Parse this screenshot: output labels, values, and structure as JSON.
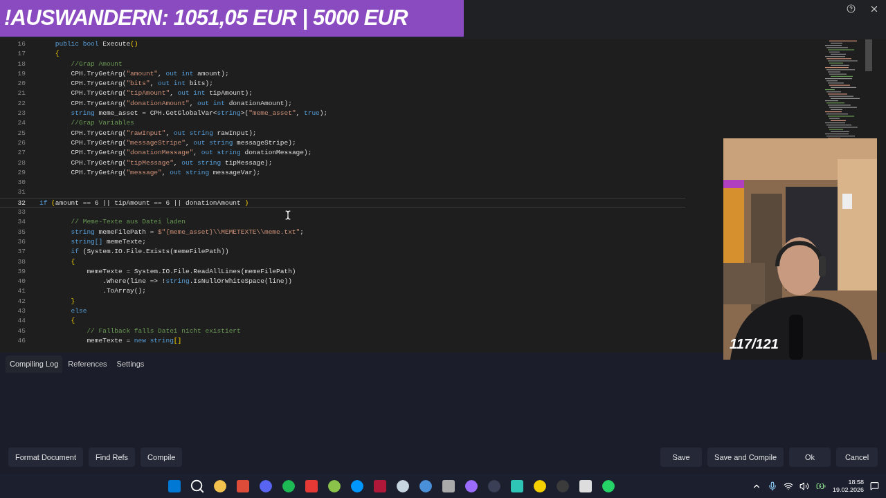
{
  "banner": {
    "text": "!AUSWANDERN: 1051,05 EUR | 5000 EUR"
  },
  "editor": {
    "lines": [
      {
        "num": "16",
        "current": false,
        "tokens": [
          {
            "kind": "keyword",
            "text": "    public bool "
          },
          {
            "kind": "plain",
            "text": "Execute"
          },
          {
            "kind": "bracket",
            "text": "()"
          }
        ]
      },
      {
        "num": "17",
        "current": false,
        "tokens": [
          {
            "kind": "bracket",
            "text": "    {"
          }
        ]
      },
      {
        "num": "18",
        "current": false,
        "tokens": [
          {
            "kind": "comment",
            "text": "        //Grap Amount"
          }
        ]
      },
      {
        "num": "19",
        "current": false,
        "tokens": [
          {
            "kind": "plain",
            "text": "        CPH.TryGetArg("
          },
          {
            "kind": "string",
            "text": "\"amount\""
          },
          {
            "kind": "plain",
            "text": ", "
          },
          {
            "kind": "keyword",
            "text": "out int "
          },
          {
            "kind": "plain",
            "text": "amount);"
          }
        ]
      },
      {
        "num": "20",
        "current": false,
        "tokens": [
          {
            "kind": "plain",
            "text": "        CPH.TryGetArg("
          },
          {
            "kind": "string",
            "text": "\"bits\""
          },
          {
            "kind": "plain",
            "text": ", "
          },
          {
            "kind": "keyword",
            "text": "out int "
          },
          {
            "kind": "plain",
            "text": "bits);"
          }
        ]
      },
      {
        "num": "21",
        "current": false,
        "tokens": [
          {
            "kind": "plain",
            "text": "        CPH.TryGetArg("
          },
          {
            "kind": "string",
            "text": "\"tipAmount\""
          },
          {
            "kind": "plain",
            "text": ", "
          },
          {
            "kind": "keyword",
            "text": "out int "
          },
          {
            "kind": "plain",
            "text": "tipAmount);"
          }
        ]
      },
      {
        "num": "22",
        "current": false,
        "tokens": [
          {
            "kind": "plain",
            "text": "        CPH.TryGetArg("
          },
          {
            "kind": "string",
            "text": "\"donationAmount\""
          },
          {
            "kind": "plain",
            "text": ", "
          },
          {
            "kind": "keyword",
            "text": "out int "
          },
          {
            "kind": "plain",
            "text": "donationAmount);"
          }
        ]
      },
      {
        "num": "23",
        "current": false,
        "tokens": [
          {
            "kind": "keyword",
            "text": "        string "
          },
          {
            "kind": "plain",
            "text": "meme_asset = CPH.GetGlobalVar<"
          },
          {
            "kind": "keyword",
            "text": "string"
          },
          {
            "kind": "plain",
            "text": ">("
          },
          {
            "kind": "string",
            "text": "\"meme_asset\""
          },
          {
            "kind": "plain",
            "text": ", "
          },
          {
            "kind": "keyword",
            "text": "true"
          },
          {
            "kind": "plain",
            "text": ");"
          }
        ]
      },
      {
        "num": "24",
        "current": false,
        "tokens": [
          {
            "kind": "comment",
            "text": "        //Grap Variables"
          }
        ]
      },
      {
        "num": "25",
        "current": false,
        "tokens": [
          {
            "kind": "plain",
            "text": "        CPH.TryGetArg("
          },
          {
            "kind": "string",
            "text": "\"rawInput\""
          },
          {
            "kind": "plain",
            "text": ", "
          },
          {
            "kind": "keyword",
            "text": "out string "
          },
          {
            "kind": "plain",
            "text": "rawInput);"
          }
        ]
      },
      {
        "num": "26",
        "current": false,
        "tokens": [
          {
            "kind": "plain",
            "text": "        CPH.TryGetArg("
          },
          {
            "kind": "string",
            "text": "\"messageStripe\""
          },
          {
            "kind": "plain",
            "text": ", "
          },
          {
            "kind": "keyword",
            "text": "out string "
          },
          {
            "kind": "plain",
            "text": "messageStripe);"
          }
        ]
      },
      {
        "num": "27",
        "current": false,
        "tokens": [
          {
            "kind": "plain",
            "text": "        CPH.TryGetArg("
          },
          {
            "kind": "string",
            "text": "\"donationMessage\""
          },
          {
            "kind": "plain",
            "text": ", "
          },
          {
            "kind": "keyword",
            "text": "out string "
          },
          {
            "kind": "plain",
            "text": "donationMessage);"
          }
        ]
      },
      {
        "num": "28",
        "current": false,
        "tokens": [
          {
            "kind": "plain",
            "text": "        CPH.TryGetArg("
          },
          {
            "kind": "string",
            "text": "\"tipMessage\""
          },
          {
            "kind": "plain",
            "text": ", "
          },
          {
            "kind": "keyword",
            "text": "out string "
          },
          {
            "kind": "plain",
            "text": "tipMessage);"
          }
        ]
      },
      {
        "num": "29",
        "current": false,
        "tokens": [
          {
            "kind": "plain",
            "text": "        CPH.TryGetArg("
          },
          {
            "kind": "string",
            "text": "\"message\""
          },
          {
            "kind": "plain",
            "text": ", "
          },
          {
            "kind": "keyword",
            "text": "out string "
          },
          {
            "kind": "plain",
            "text": "messageVar);"
          }
        ]
      },
      {
        "num": "30",
        "current": false
      },
      {
        "num": "31",
        "current": false
      },
      {
        "num": "32",
        "current": true,
        "tokens": [
          {
            "kind": "keyword",
            "text": "if "
          },
          {
            "kind": "bracket",
            "text": "("
          },
          {
            "kind": "plain",
            "text": "amount == 6 || tipAmount == 6 || donationAmount "
          },
          {
            "kind": "bracket",
            "text": ")"
          }
        ]
      },
      {
        "num": "33",
        "current": false
      },
      {
        "num": "34",
        "current": false,
        "tokens": [
          {
            "kind": "comment",
            "text": "        // Meme-Texte aus Datei laden"
          }
        ]
      },
      {
        "num": "35",
        "current": false,
        "tokens": [
          {
            "kind": "keyword",
            "text": "        string "
          },
          {
            "kind": "plain",
            "text": "memeFilePath = "
          },
          {
            "kind": "string",
            "text": "$\"{meme_asset}\\\\MEMETEXTE\\\\meme.txt\""
          },
          {
            "kind": "plain",
            "text": ";"
          }
        ]
      },
      {
        "num": "36",
        "current": false,
        "tokens": [
          {
            "kind": "keyword",
            "text": "        string[] "
          },
          {
            "kind": "plain",
            "text": "memeTexte;"
          }
        ]
      },
      {
        "num": "37",
        "current": false,
        "tokens": [
          {
            "kind": "keyword",
            "text": "        if "
          },
          {
            "kind": "plain",
            "text": "(System.IO.File.Exists(memeFilePath))"
          }
        ]
      },
      {
        "num": "38",
        "current": false,
        "tokens": [
          {
            "kind": "bracket",
            "text": "        {"
          }
        ]
      },
      {
        "num": "39",
        "current": false,
        "tokens": [
          {
            "kind": "plain",
            "text": "            memeTexte = System.IO.File.ReadAllLines(memeFilePath)"
          }
        ]
      },
      {
        "num": "40",
        "current": false,
        "tokens": [
          {
            "kind": "plain",
            "text": "                .Where(line => !"
          },
          {
            "kind": "keyword",
            "text": "string"
          },
          {
            "kind": "plain",
            "text": ".IsNullOrWhiteSpace(line))"
          }
        ]
      },
      {
        "num": "41",
        "current": false,
        "tokens": [
          {
            "kind": "plain",
            "text": "                .ToArray();"
          }
        ]
      },
      {
        "num": "42",
        "current": false,
        "tokens": [
          {
            "kind": "bracket",
            "text": "        }"
          }
        ]
      },
      {
        "num": "43",
        "current": false,
        "tokens": [
          {
            "kind": "keyword",
            "text": "        else"
          }
        ]
      },
      {
        "num": "44",
        "current": false,
        "tokens": [
          {
            "kind": "bracket",
            "text": "        {"
          }
        ]
      },
      {
        "num": "45",
        "current": false,
        "tokens": [
          {
            "kind": "comment",
            "text": "            // Fallback falls Datei nicht existiert"
          }
        ]
      },
      {
        "num": "46",
        "current": false,
        "tokens": [
          {
            "kind": "plain",
            "text": "            memeTexte = "
          },
          {
            "kind": "keyword",
            "text": "new string"
          },
          {
            "kind": "bracket",
            "text": "[]"
          }
        ]
      }
    ]
  },
  "webcam": {
    "counter": "117/121"
  },
  "tabs": [
    {
      "label": "Compiling Log",
      "selected": true
    },
    {
      "label": "References",
      "selected": false
    },
    {
      "label": "Settings",
      "selected": false
    }
  ],
  "left_buttons": [
    "Format Document",
    "Find Refs",
    "Compile"
  ],
  "right_buttons": [
    "Save",
    "Save and Compile",
    "Ok",
    "Cancel"
  ],
  "taskbar": {
    "time": "18:58",
    "date": "19.02.2026"
  }
}
